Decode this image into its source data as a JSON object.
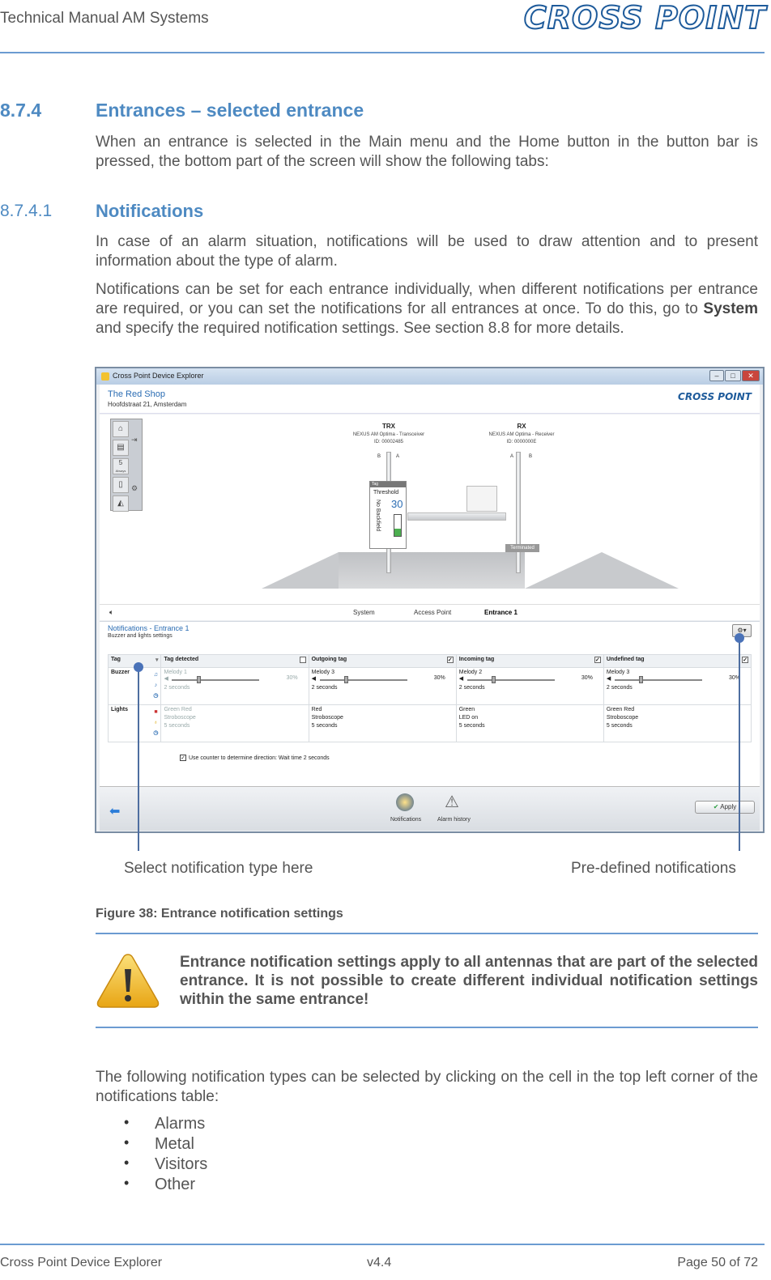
{
  "header": {
    "title": "Technical Manual AM Systems",
    "logo_text": "CROSS POINT"
  },
  "section": {
    "number": "8.7.4",
    "title": "Entrances – selected entrance",
    "intro": "When an entrance is selected in the Main menu and the Home button in the button bar is pressed, the bottom part of the screen will show the following tabs:"
  },
  "subsection": {
    "number": "8.7.4.1",
    "title": "Notifications",
    "para1": "In case of an alarm situation, notifications will be used to draw attention and to present information about the type of alarm.",
    "para2_before": "Notifications can be set for each entrance individually, when different notifications per entrance are required, or you can set the notifications for all entrances at once. To do this, go to ",
    "para2_bold": "System",
    "para2_after": " and specify the required notification settings. See section 8.8 for more details."
  },
  "screenshot": {
    "window_title": "Cross Point Device Explorer",
    "shop_name": "The Red Shop",
    "shop_address": "Hoofdstraat 21, Amsterdam",
    "brand": "CROSS POINT",
    "trx": {
      "title": "TRX",
      "sub": "NEXUS AM Optima - Transceiver",
      "id": "ID: 00002485",
      "b": "B",
      "a": "A"
    },
    "rx": {
      "title": "RX",
      "sub": "NEXUS AM Optima - Receiver",
      "id": "ID: 0000000E",
      "a": "A",
      "b": "B"
    },
    "threshold_label": "Threshold",
    "threshold_value": "30",
    "no_backfield": "No Backfield",
    "tag_label": "Tag",
    "terminated": "Terminated",
    "side_count": "5",
    "side_sub": "Always",
    "tabs": [
      "System",
      "Access Point",
      "Entrance 1"
    ],
    "active_tab": "Entrance 1",
    "notif_title": "Notifications - Entrance 1",
    "notif_sub": "Buzzer and lights settings",
    "table": {
      "headers": [
        "Tag",
        "Tag detected",
        "Outgoing tag",
        "Incoming tag",
        "Undefined tag"
      ],
      "buzzer_label": "Buzzer",
      "lights_label": "Lights",
      "buzzer": [
        {
          "melody": "Melody 1",
          "volume": "30%",
          "volume_level": 0.3,
          "time": "2 seconds",
          "disabled": true
        },
        {
          "melody": "Melody 3",
          "volume": "30%",
          "volume_level": 0.3,
          "time": "2 seconds",
          "disabled": false
        },
        {
          "melody": "Melody 2",
          "volume": "30%",
          "volume_level": 0.3,
          "time": "2 seconds",
          "disabled": false
        },
        {
          "melody": "Melody 3",
          "volume": "30%",
          "volume_level": 0.3,
          "time": "2 seconds",
          "disabled": false
        }
      ],
      "lights": [
        {
          "color": "Green Red",
          "mode": "Stroboscope",
          "time": "5 seconds",
          "disabled": true
        },
        {
          "color": "Red",
          "mode": "Stroboscope",
          "time": "5 seconds",
          "disabled": false
        },
        {
          "color": "Green",
          "mode": "LED on",
          "time": "5 seconds",
          "disabled": false
        },
        {
          "color": "Green Red",
          "mode": "Stroboscope",
          "time": "5 seconds",
          "disabled": false
        }
      ]
    },
    "use_counter": "Use counter to determine direction: Wait time",
    "use_counter_value": "2 seconds",
    "bottom": {
      "notifications": "Notifications",
      "alarm_history": "Alarm history",
      "apply": "Apply"
    }
  },
  "callouts": {
    "left": "Select notification type here",
    "right": "Pre-defined notifications"
  },
  "figure_caption": "Figure 38: Entrance notification settings",
  "warning": "Entrance notification settings apply to all antennas that are part of the selected entrance. It is not possible to create different individual notification settings within the same entrance!",
  "types_intro": "The following notification types can be selected by clicking on the cell in the top left corner of the notifications table:",
  "types": [
    "Alarms",
    "Metal",
    "Visitors",
    "Other"
  ],
  "footer": {
    "left": "Cross Point Device Explorer",
    "center": "v4.4",
    "right": "Page 50 of 72"
  },
  "colors": {
    "heading": "#4e8ac2",
    "rule": "#6b9bd1",
    "brand": "#1e5b9b"
  }
}
